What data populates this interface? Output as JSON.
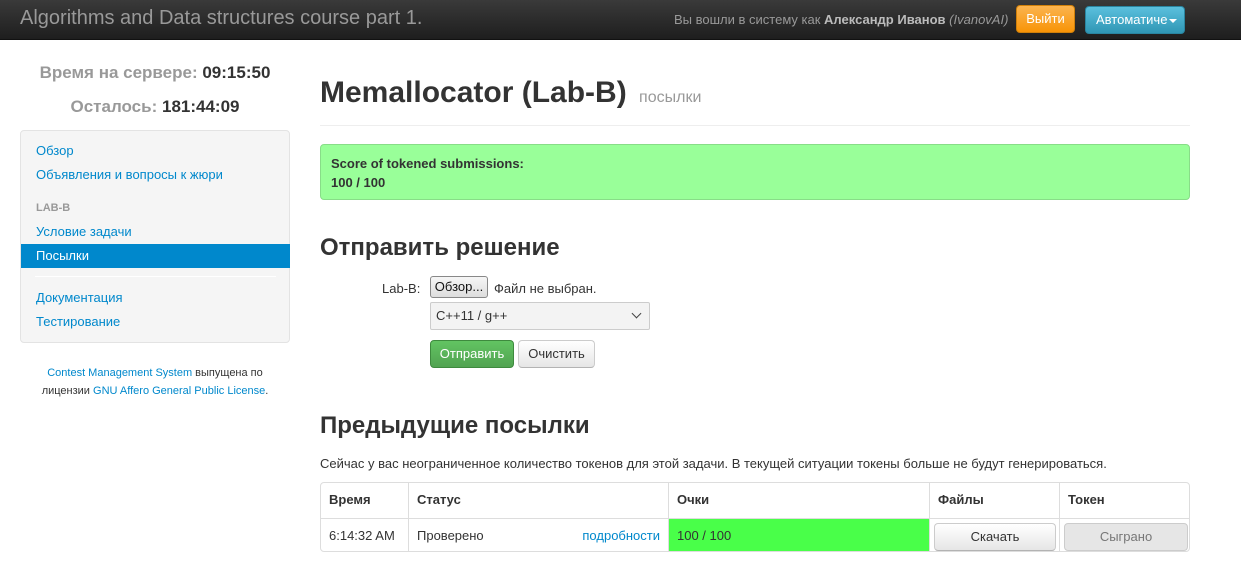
{
  "navbar": {
    "brand": "Algorithms and Data structures course part 1.",
    "login_prefix": "Вы вошли в систему как",
    "user_name": "Александр Иванов",
    "user_login": "(IvanovAI)",
    "logout_label": "Выйти",
    "language_label": "Автоматиче"
  },
  "sidebar": {
    "server_time_label": "Время на сервере:",
    "server_time": "09:15:50",
    "remaining_label": "Осталось:",
    "remaining": "181:44:09",
    "items": [
      {
        "label": "Обзор"
      },
      {
        "label": "Объявления и вопросы к жюри"
      }
    ],
    "task_header": "LAB-B",
    "task_items": [
      {
        "label": "Условие задачи"
      },
      {
        "label": "Посылки"
      }
    ],
    "bottom_items": [
      {
        "label": "Документация"
      },
      {
        "label": "Тестирование"
      }
    ],
    "footer": {
      "cms_link": "Contest Management System",
      "text1": " выпущена по",
      "text2": "лицензии ",
      "license_link": "GNU Affero General Public License",
      "text3": "."
    }
  },
  "main": {
    "title": "Memallocator (Lab-B)",
    "subtitle": "посылки",
    "score_label": "Score of tokened submissions:",
    "score_value": "100 / 100",
    "submit_heading": "Отправить решение",
    "file_label": "Lab-B:",
    "browse_label": "Обзор...",
    "file_status": "Файл не выбран.",
    "language_selected": "C++11 / g++",
    "send_label": "Отправить",
    "clear_label": "Очистить",
    "previous_heading": "Предыдущие посылки",
    "token_info": "Сейчас у вас неограниченное количество токенов для этой задачи. В текущей ситуации токены больше не будут генерироваться."
  },
  "table": {
    "headers": [
      "Время",
      "Статус",
      "Очки",
      "Файлы",
      "Токен"
    ],
    "rows": [
      {
        "time": "6:14:32 AM",
        "status": "Проверено",
        "details": "подробности",
        "score": "100 / 100",
        "download": "Скачать",
        "token": "Сыграно"
      }
    ]
  },
  "colors": {
    "navbar": "#2c2c2c",
    "logout": "#f89406",
    "language": "#2f96b4",
    "link": "#0088cc",
    "score_box": "#99ff99",
    "score_cell": "#49ff49",
    "send_button": "#51a351"
  }
}
